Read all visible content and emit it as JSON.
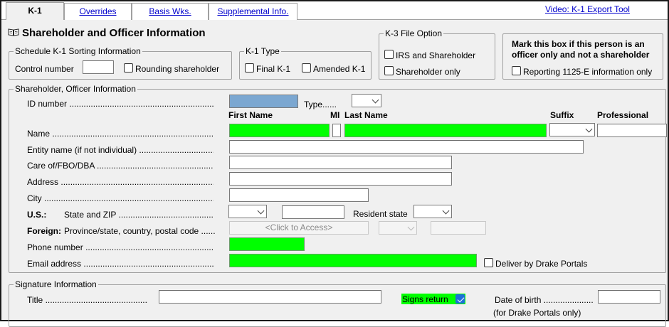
{
  "tabs": [
    {
      "label": "K-1",
      "active": true
    },
    {
      "label": "Overrides"
    },
    {
      "label": "Basis Wks."
    },
    {
      "label": "Supplemental Info."
    }
  ],
  "video_link": "Video: K-1 Export Tool",
  "page_title": "Shareholder and Officer Information",
  "sorting": {
    "title": "Schedule K-1 Sorting Information",
    "control_number_label": "Control number",
    "rounding_label": "Rounding shareholder"
  },
  "k1_type": {
    "title": "K-1 Type",
    "final_label": "Final K-1",
    "amended_label": "Amended K-1"
  },
  "k3": {
    "title": "K-3 File Option",
    "irs_label": "IRS and Shareholder",
    "shareholder_only_label": "Shareholder only"
  },
  "officer_box": {
    "heading_line1": "Mark this box if this person is an",
    "heading_line2": "officer only and not a shareholder",
    "reporting_label": "Reporting 1125-E information only"
  },
  "info": {
    "title": "Shareholder, Officer Information",
    "id_number_label": "ID number",
    "type_label": "Type......",
    "col_first": "First Name",
    "col_mi": "MI",
    "col_last": "Last Name",
    "col_suffix": "Suffix",
    "col_professional": "Professional",
    "name_label": "Name",
    "entity_label": "Entity name (if not individual)",
    "careof_label": "Care of/FBO/DBA",
    "address_label": "Address",
    "city_label": "City",
    "us_label": "U.S.:",
    "state_zip_label": "State and ZIP",
    "resident_state_label": "Resident state",
    "foreign_label": "Foreign:",
    "province_label": "Province/state, country, postal code",
    "click_to_access": "<Click to Access>",
    "phone_label": "Phone number",
    "email_label": "Email address",
    "deliver_label": "Deliver by Drake Portals"
  },
  "signature": {
    "title": "Signature Information",
    "title_label": "Title",
    "signs_return_label": "Signs return",
    "signs_return_checked": true,
    "dob_label": "Date of birth",
    "dob_note": "(for Drake Portals only)"
  },
  "colors": {
    "required_field": "#00ff00",
    "id_field": "#7ba7d1",
    "link": "#0000cc"
  },
  "icons": {
    "title_icon": "book-icon"
  }
}
